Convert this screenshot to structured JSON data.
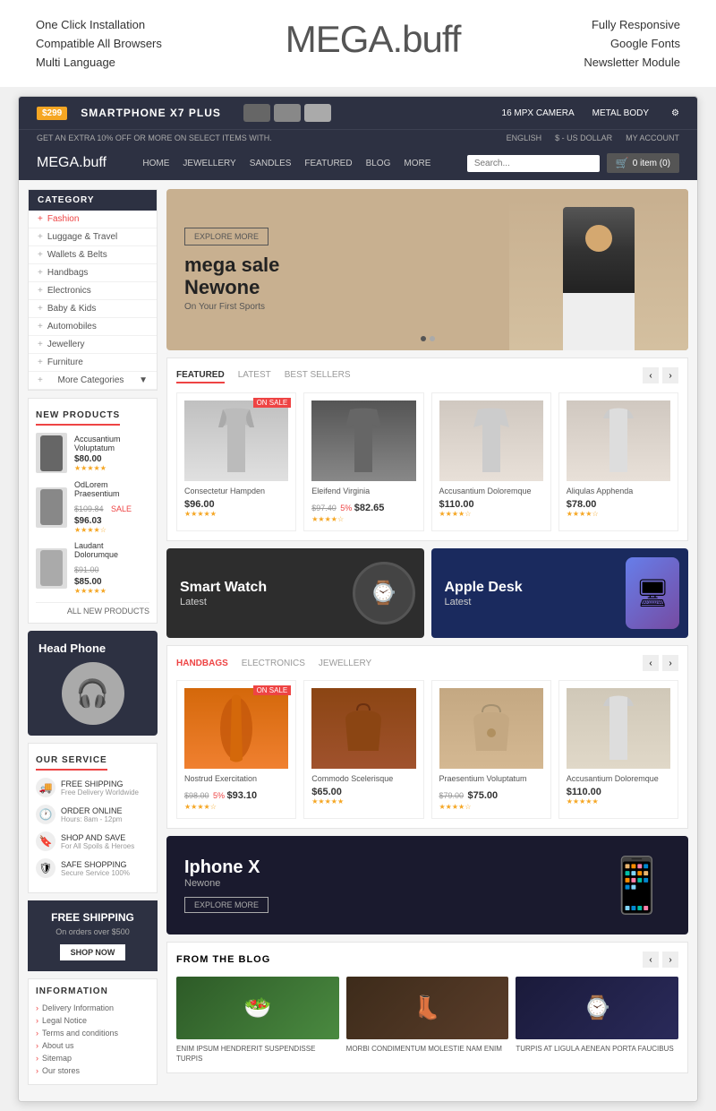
{
  "topbar": {
    "left": [
      "One Click Installation",
      "Compatible All Browsers",
      "Multi Language"
    ],
    "brand": "MEGA",
    "brandSuffix": ".buff",
    "right": [
      "Fully Responsive",
      "Google Fonts",
      "Newsletter Module"
    ]
  },
  "promo": {
    "price": "$299",
    "title": "SMARTPHONE X7 PLUS",
    "camera": "16 MPX CAMERA",
    "body": "METAL BODY"
  },
  "notif": {
    "left": "GET AN EXTRA 10% OFF OR MORE ON SELECT ITEMS WITH.",
    "language": "ENGLISH",
    "currency": "$ - US DOLLAR",
    "account": "MY ACCOUNT"
  },
  "nav": {
    "logo": "MEGA",
    "logoSuffix": ".buff",
    "links": [
      "HOME",
      "JEWELLERY",
      "SANDLES",
      "FEATURED",
      "BLOG",
      "MORE"
    ],
    "cartCount": "0 item (0)"
  },
  "categories": [
    "Fashion",
    "Luggage & Travel",
    "Wallets & Belts",
    "Handbags",
    "Electronics",
    "Baby & Kids",
    "Automobiles",
    "Jewellery",
    "Furniture",
    "More Categories"
  ],
  "newProducts": {
    "title": "NEW PRODUCTS",
    "items": [
      {
        "name": "Accusantium Voluptatum",
        "price": "$80.00"
      },
      {
        "name": "OdLorem Praesentium",
        "oldPrice": "$109.84",
        "price": "$96.03",
        "sale": true
      },
      {
        "name": "Laudant Dolorumque",
        "oldPrice": "$91.00",
        "price": "$85.00"
      }
    ],
    "allLink": "ALL NEW PRODUCTS"
  },
  "headphone": {
    "title": "Head Phone"
  },
  "services": [
    {
      "icon": "🚚",
      "title": "FREE SHIPPING",
      "sub": "Free Delivery Worldwide"
    },
    {
      "icon": "🕐",
      "title": "ORDER ONLINE",
      "sub": "Hours: 8am - 12pm"
    },
    {
      "icon": "🔖",
      "title": "SHOP AND SAVE",
      "sub": "For All Spoils & Heroes"
    },
    {
      "icon": "🛡",
      "title": "SAFE SHOPPING",
      "sub": "Secure Service 100%"
    }
  ],
  "freeShipping": {
    "title": "FREE SHIPPING",
    "sub": "On orders over $500",
    "btn": "SHOP NOW"
  },
  "information": {
    "title": "INFORMATION",
    "items": [
      "Delivery Information",
      "Legal Notice",
      "Terms and conditions",
      "About us",
      "Sitemap",
      "Our stores"
    ]
  },
  "hero": {
    "explore": "EXPLORE MORE",
    "heading1": "mega sale",
    "heading2": "Newone",
    "sub": "On Your First Sports"
  },
  "productTabs": {
    "tabs": [
      "FEATURED",
      "LATEST",
      "BEST SELLERS"
    ],
    "products": [
      {
        "name": "Consectetur Hampden",
        "price": "$96.00",
        "onSale": true
      },
      {
        "name": "Eleifend Virginia",
        "oldPrice": "$97.40",
        "salePercent": "5%",
        "price": "$82.65"
      },
      {
        "name": "Accusantium Doloremque",
        "price": "$110.00"
      },
      {
        "name": "Aliqulas Apphenda",
        "price": "$78.00"
      }
    ]
  },
  "banners": {
    "smartWatch": {
      "title": "Smart Watch",
      "sub": "Latest"
    },
    "appleDesk": {
      "title": "Apple Desk",
      "sub": "Latest"
    }
  },
  "categoryTabs": {
    "tabs": [
      "HANDBAGS",
      "ELECTRONICS",
      "JEWELLERY"
    ],
    "products": [
      {
        "name": "Nostrud Exercitation",
        "oldPrice": "$98.00",
        "salePercent": "5%",
        "price": "$93.10",
        "onSale": true
      },
      {
        "name": "Commodo Scelerisque",
        "price": "$65.00"
      },
      {
        "name": "Praesentium Voluptatum",
        "oldPrice": "$79.00",
        "price": "$75.00"
      },
      {
        "name": "Accusantium Doloremque",
        "price": "$110.00"
      }
    ]
  },
  "iphoneBanner": {
    "title": "Iphone X",
    "sub": "Newone",
    "btn": "EXPLORE MORE"
  },
  "blog": {
    "title": "FROM THE BLOG",
    "posts": [
      {
        "caption": "ENIM IPSUM HENDRERIT SUSPENDISSE TURPIS"
      },
      {
        "caption": "MORBI CONDIMENTUM MOLESTIE NAM ENIM"
      },
      {
        "caption": "TURPIS AT LIGULA AENEAN PORTA FAUCIBUS"
      }
    ]
  }
}
